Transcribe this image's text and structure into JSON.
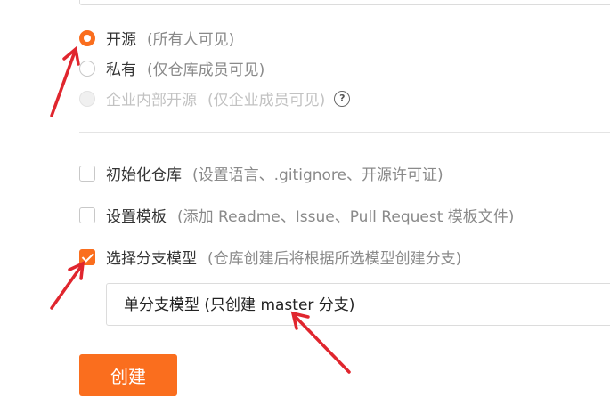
{
  "visibility": {
    "options": [
      {
        "label": "开源",
        "hint": "(所有人可见)",
        "state": "checked"
      },
      {
        "label": "私有",
        "hint": "(仅仓库成员可见)",
        "state": "unchecked"
      },
      {
        "label": "企业内部开源",
        "hint": "(仅企业成员可见)",
        "state": "disabled"
      }
    ],
    "help_icon": "question-circle-icon"
  },
  "settings": {
    "items": [
      {
        "label": "初始化仓库",
        "hint": "(设置语言、.gitignore、开源许可证)",
        "checked": false
      },
      {
        "label": "设置模板",
        "hint": "(添加 Readme、Issue、Pull Request 模板文件)",
        "checked": false
      },
      {
        "label": "选择分支模型",
        "hint": "(仓库创建后将根据所选模型创建分支)",
        "checked": true
      }
    ]
  },
  "branch_model": {
    "selected": "单分支模型 (只创建 master 分支)"
  },
  "actions": {
    "create_label": "创建"
  },
  "colors": {
    "accent": "#fa6e1e",
    "annotation_arrow": "#e0262e"
  }
}
